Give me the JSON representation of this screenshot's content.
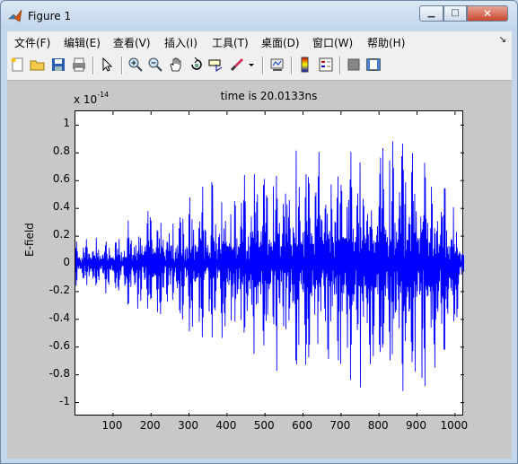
{
  "window": {
    "title": "Figure 1",
    "min_label": "▁",
    "max_label": "□",
    "close_label": "✕"
  },
  "menu": [
    "文件(F)",
    "编辑(E)",
    "查看(V)",
    "插入(I)",
    "工具(T)",
    "桌面(D)",
    "窗口(W)",
    "帮助(H)"
  ],
  "menu_arrow": "↘",
  "toolbar": [
    "new-figure-icon",
    "open-file-icon",
    "save-icon",
    "print-icon",
    "pointer-icon",
    "zoom-in-icon",
    "zoom-out-icon",
    "pan-icon",
    "rotate-3d-icon",
    "data-cursor-icon",
    "brush-icon",
    "brush-menu-icon",
    "link-plot-icon",
    "colorbar-icon",
    "legend-icon",
    "hide-plot-tools-icon",
    "show-plot-tools-icon"
  ],
  "plot": {
    "title": "time is 20.0133ns",
    "exponent_base": "x 10",
    "exponent_power": "-14",
    "ylabel": "E-field"
  },
  "chart_data": {
    "type": "line",
    "title": "time is 20.0133ns",
    "xlabel": "",
    "ylabel": "E-field",
    "y_multiplier": "x 10^-14",
    "xlim": [
      1,
      1024
    ],
    "ylim": [
      -1.1,
      1.1
    ],
    "xticks": [
      100,
      200,
      300,
      400,
      500,
      600,
      700,
      800,
      900,
      1000
    ],
    "yticks": [
      -1,
      -0.8,
      -0.6,
      -0.4,
      -0.2,
      0,
      0.2,
      0.4,
      0.6,
      0.8,
      1
    ],
    "ytick_labels": [
      "-1",
      "-0.8",
      "-0.6",
      "-0.4",
      "-0.2",
      "0",
      "0.2",
      "0.4",
      "0.6",
      "0.8",
      "1"
    ],
    "color": "#0000ff",
    "envelope": {
      "x": [
        1,
        50,
        100,
        150,
        200,
        250,
        300,
        350,
        400,
        450,
        500,
        550,
        600,
        650,
        700,
        750,
        800,
        850,
        880,
        900,
        950,
        1000,
        1024
      ],
      "upper": [
        0.2,
        0.22,
        0.23,
        0.35,
        0.45,
        0.55,
        0.6,
        0.65,
        0.7,
        0.75,
        0.82,
        0.85,
        0.9,
        0.95,
        1.0,
        0.98,
        1.02,
        1.05,
        1.12,
        1.08,
        0.95,
        0.6,
        0.3
      ],
      "lower": [
        -0.2,
        -0.22,
        -0.25,
        -0.4,
        -0.45,
        -0.35,
        -0.55,
        -0.55,
        -0.7,
        -0.75,
        -0.8,
        -0.78,
        -0.9,
        -0.95,
        -0.98,
        -0.98,
        -1.0,
        -1.02,
        -1.1,
        -1.05,
        -0.9,
        -0.55,
        -0.3
      ]
    },
    "samples": 1024
  }
}
